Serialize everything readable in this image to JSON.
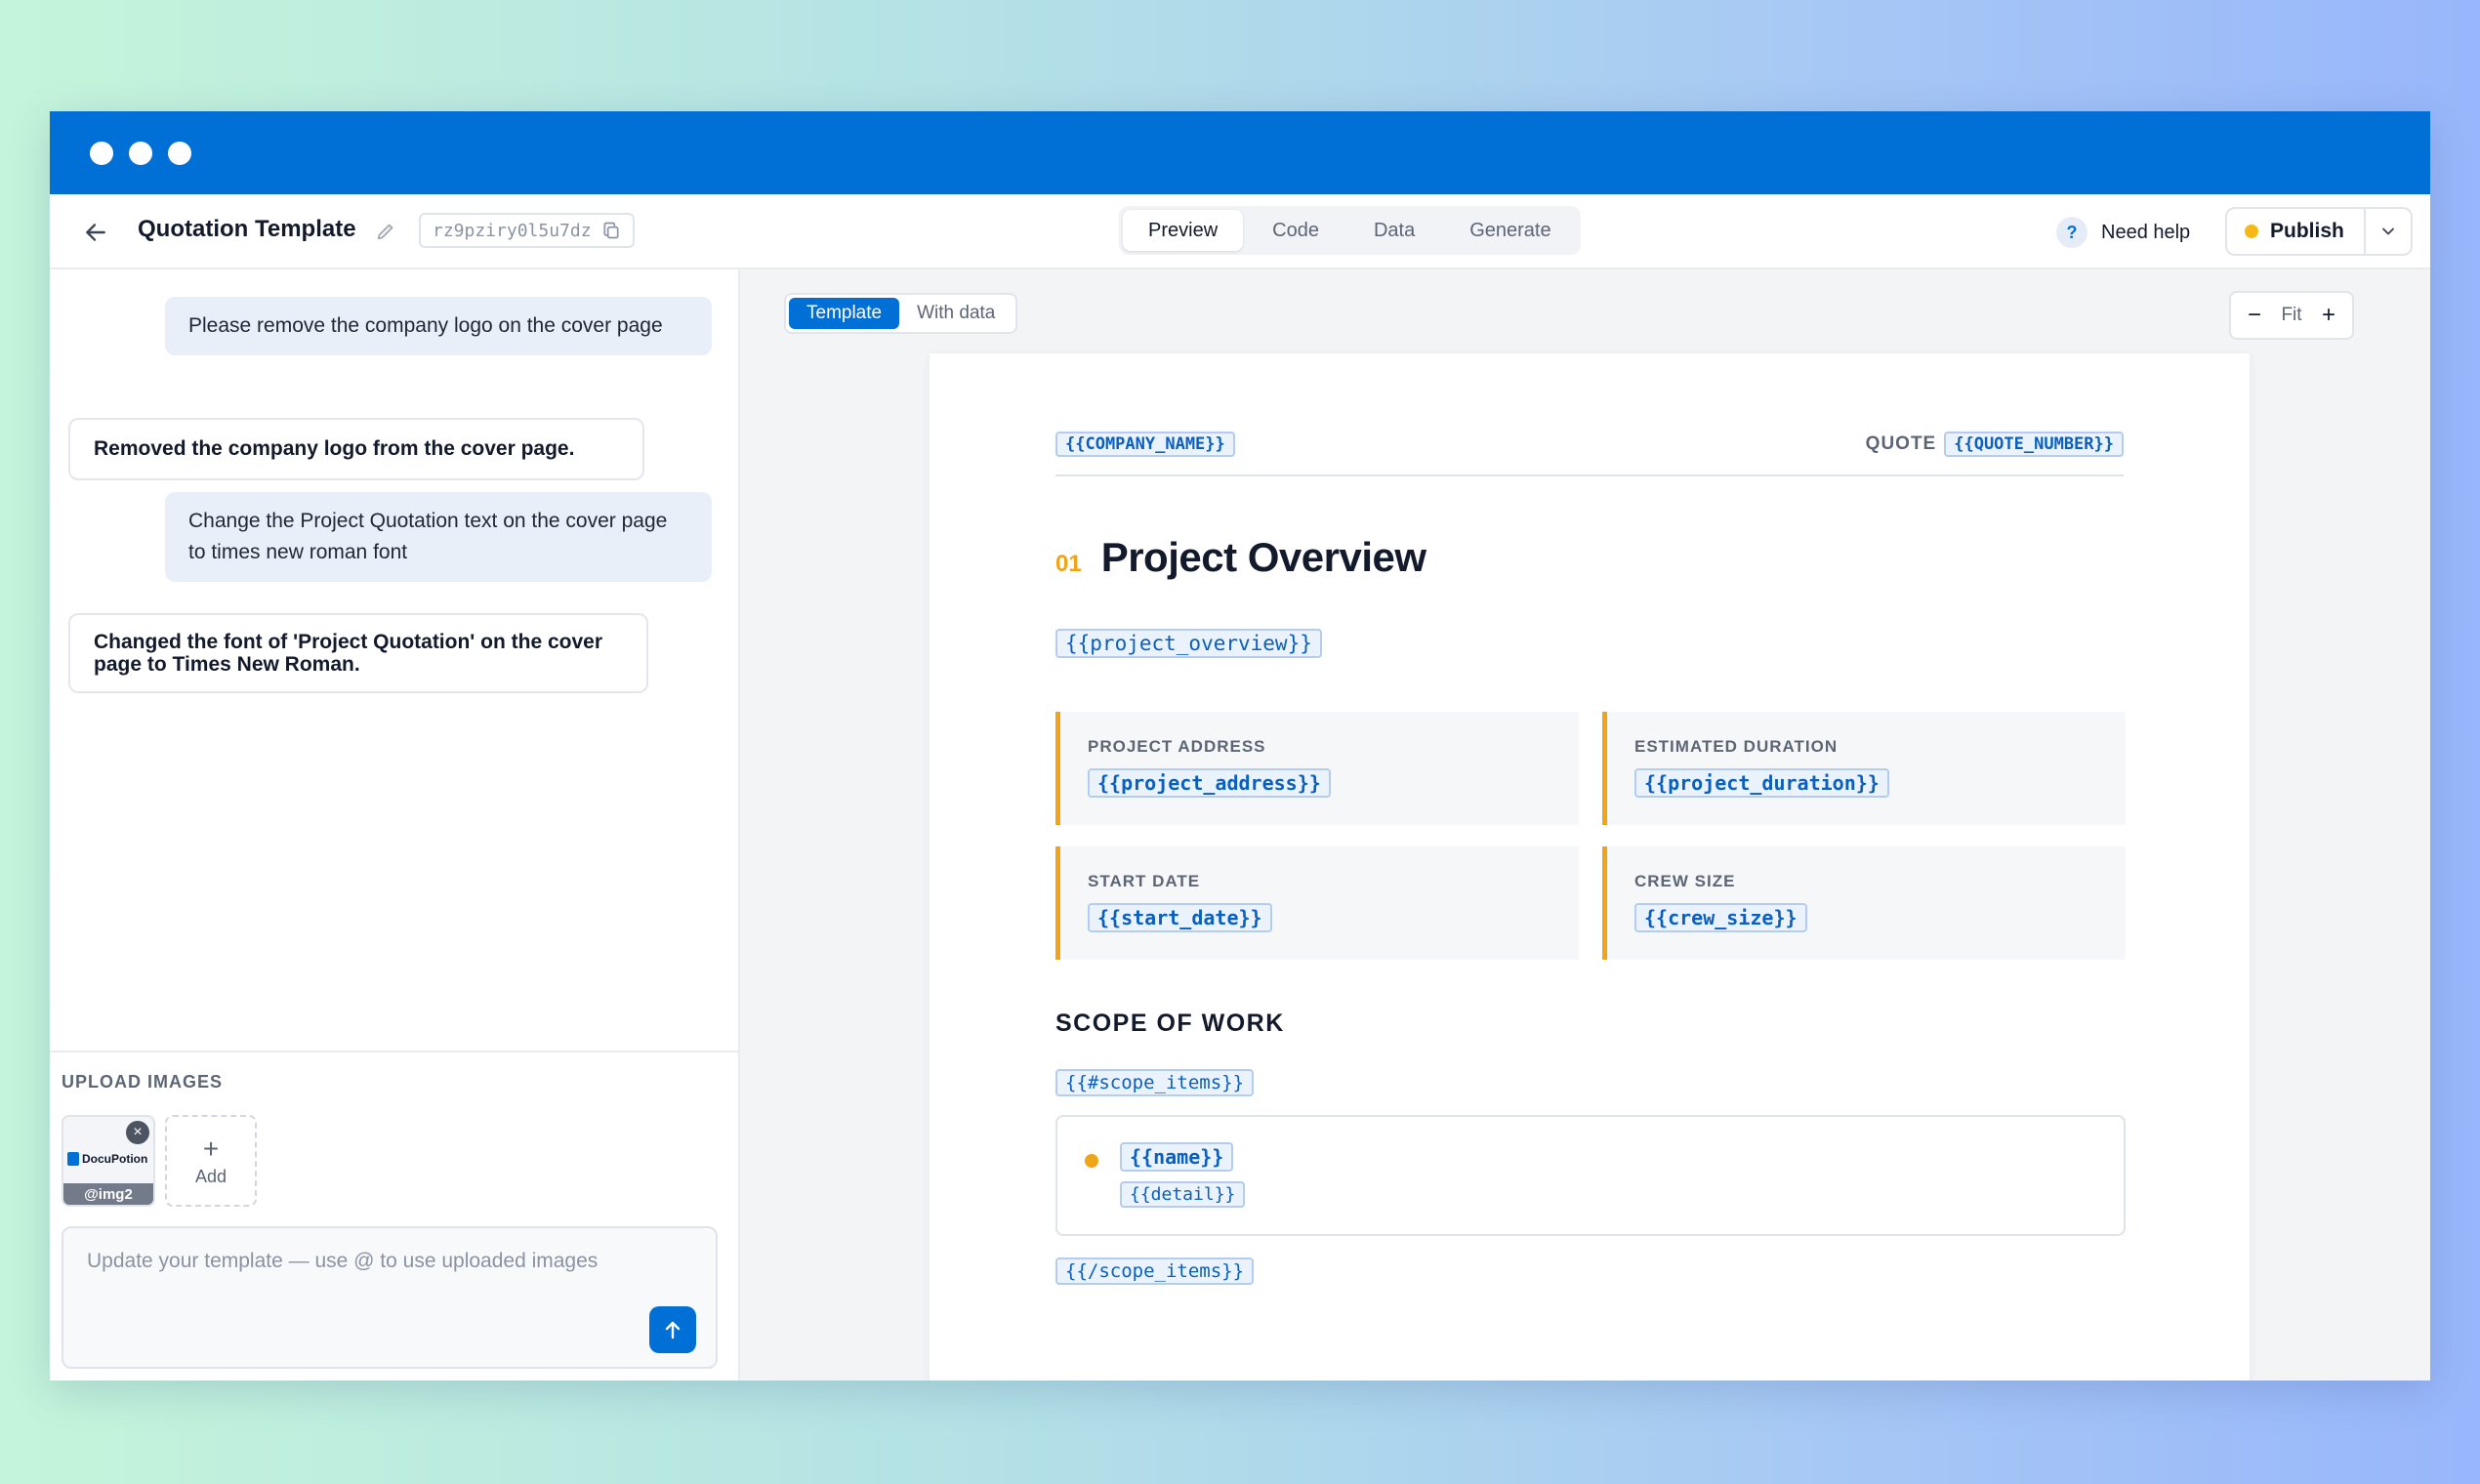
{
  "header": {
    "title": "Quotation Template",
    "template_id": "rz9pziry0l5u7dz",
    "tabs": [
      {
        "label": "Preview",
        "active": true
      },
      {
        "label": "Code",
        "active": false
      },
      {
        "label": "Data",
        "active": false
      },
      {
        "label": "Generate",
        "active": false
      }
    ],
    "help_label": "Need help",
    "help_glyph": "?",
    "publish_label": "Publish",
    "publish_status_color": "#f5b814"
  },
  "chat": {
    "messages": [
      {
        "role": "user",
        "text": "Please remove the company logo on the cover page"
      },
      {
        "role": "assistant",
        "text": "Removed the company logo from the cover page."
      },
      {
        "role": "user",
        "text": "Change the Project Quotation text on the cover page to times new roman font"
      },
      {
        "role": "assistant",
        "text": "Changed the font of 'Project Quotation' on the cover page to Times New Roman."
      }
    ],
    "upload_label": "UPLOAD IMAGES",
    "uploaded": {
      "logo_text": "DocuPotion",
      "tag": "@img2"
    },
    "add_label": "Add",
    "input_placeholder": "Update your template — use @ to use uploaded images"
  },
  "preview": {
    "view_toggle": [
      {
        "label": "Template",
        "active": true
      },
      {
        "label": "With data",
        "active": false
      }
    ],
    "zoom": {
      "minus": "−",
      "fit_label": "Fit",
      "plus": "+"
    },
    "document": {
      "company_tag": "{{COMPANY_NAME}}",
      "quote_label": "QUOTE",
      "quote_tag": "{{QUOTE_NUMBER}}",
      "section_number": "01",
      "section_title": "Project Overview",
      "overview_tag": "{{project_overview}}",
      "cards": [
        {
          "label": "PROJECT ADDRESS",
          "tag": "{{project_address}}"
        },
        {
          "label": "ESTIMATED DURATION",
          "tag": "{{project_duration}}"
        },
        {
          "label": "START DATE",
          "tag": "{{start_date}}"
        },
        {
          "label": "CREW SIZE",
          "tag": "{{crew_size}}"
        }
      ],
      "scope_title": "SCOPE OF WORK",
      "scope_open_tag": "{{#scope_items}}",
      "item_name_tag": "{{name}}",
      "item_detail_tag": "{{detail}}",
      "scope_close_tag": "{{/scope_items}}",
      "accent_color": "#f0a417"
    }
  },
  "colors": {
    "brand": "#0070d6",
    "tag_text": "#0a5fbf",
    "tag_bg": "#eaf2fc"
  }
}
